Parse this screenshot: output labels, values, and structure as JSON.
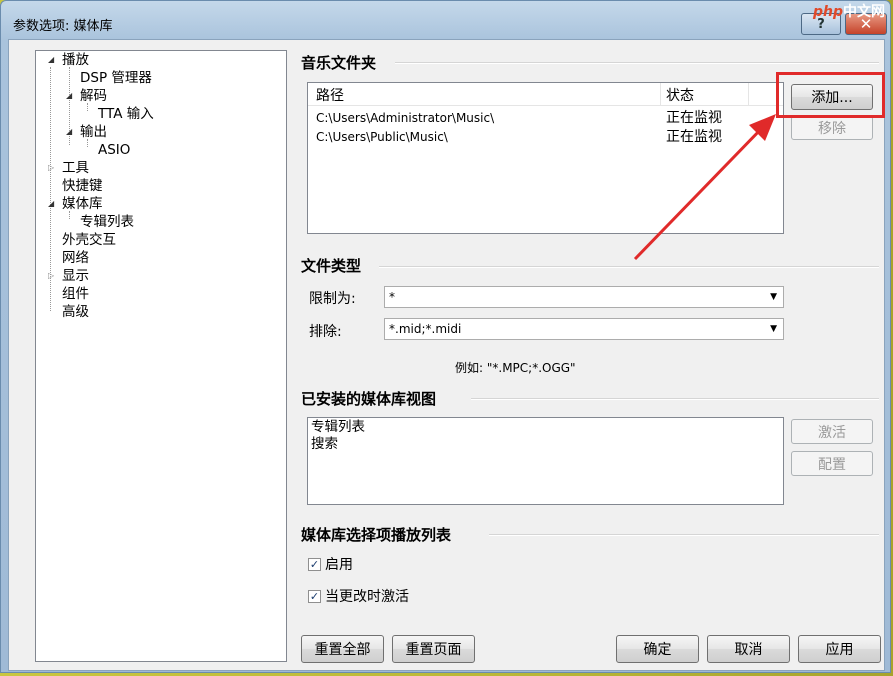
{
  "window": {
    "title": "参数选项: 媒体库",
    "help_label": "?",
    "close_label": "✕"
  },
  "watermark": {
    "brand_left": "php",
    "brand_right": "中文网"
  },
  "tree": [
    {
      "label": "播放"
    },
    {
      "label": "DSP 管理器"
    },
    {
      "label": "解码"
    },
    {
      "label": "TTA 输入"
    },
    {
      "label": "输出"
    },
    {
      "label": "ASIO"
    },
    {
      "label": "工具"
    },
    {
      "label": "快捷键"
    },
    {
      "label": "媒体库"
    },
    {
      "label": "专辑列表"
    },
    {
      "label": "外壳交互"
    },
    {
      "label": "网络"
    },
    {
      "label": "显示"
    },
    {
      "label": "组件"
    },
    {
      "label": "高级"
    }
  ],
  "music_folders": {
    "heading": "音乐文件夹",
    "columns": [
      "路径",
      "状态"
    ],
    "rows": [
      {
        "path": "C:\\Users\\Administrator\\Music\\",
        "status": "正在监视"
      },
      {
        "path": "C:\\Users\\Public\\Music\\",
        "status": "正在监视"
      }
    ],
    "add_label": "添加...",
    "remove_label": "移除"
  },
  "file_types": {
    "heading": "文件类型",
    "restrict_label": "限制为:",
    "restrict_value": "*",
    "exclude_label": "排除:",
    "exclude_value": "*.mid;*.midi",
    "example": "例如: \"*.MPC;*.OGG\""
  },
  "views": {
    "heading": "已安装的媒体库视图",
    "items": [
      "专辑列表",
      "搜索"
    ],
    "activate_label": "激活",
    "configure_label": "配置"
  },
  "playlist": {
    "heading": "媒体库选择项播放列表",
    "enable_label": "启用",
    "activate_on_change_label": "当更改时激活"
  },
  "footer": {
    "reset_all": "重置全部",
    "reset_page": "重置页面",
    "ok": "确定",
    "cancel": "取消",
    "apply": "应用"
  },
  "colors": {
    "annotation_red": "#e02a2a"
  }
}
